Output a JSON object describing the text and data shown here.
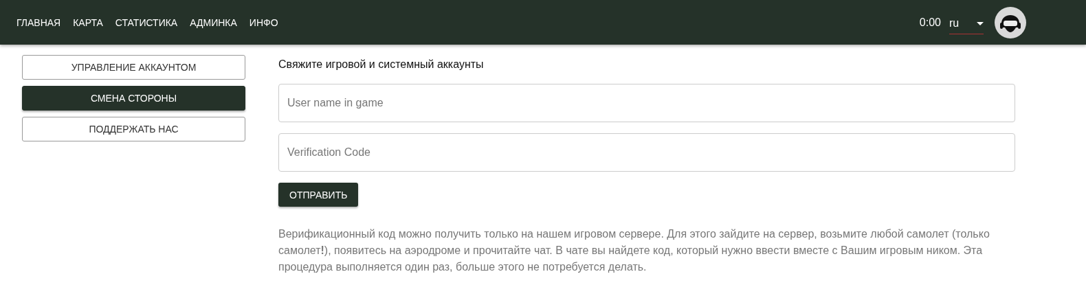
{
  "nav": {
    "items": [
      {
        "label": "ГЛАВНАЯ"
      },
      {
        "label": "КАРТА"
      },
      {
        "label": "СТАТИСТИКА"
      },
      {
        "label": "АДМИНКА"
      },
      {
        "label": "ИНФО"
      }
    ],
    "time": "0:00",
    "language": "ru"
  },
  "sidebar": {
    "items": [
      {
        "label": "УПРАВЛЕНИЕ АККАУНТОМ",
        "selected": false
      },
      {
        "label": "СМЕНА СТОРОНЫ",
        "selected": true
      },
      {
        "label": "ПОДДЕРЖАТЬ НАС",
        "selected": false
      }
    ]
  },
  "form": {
    "heading": "Свяжите игровой и системный аккаунты",
    "fields": [
      {
        "placeholder": "User name in game"
      },
      {
        "placeholder": "Verification Code"
      }
    ],
    "submit": "ОТПРАВИТЬ",
    "note": "Верификационный код можно получить только на нашем игровом сервере. Для этого зайдите на сервер, возьмите любой самолет (только самолет**!**), появитесь на аэродроме и прочитайте чат. В чате вы найдете код, который нужно ввести вместе с Вашим игровым ником. Эта процедура выполняется один раз, больше этого не потребуется делать."
  }
}
